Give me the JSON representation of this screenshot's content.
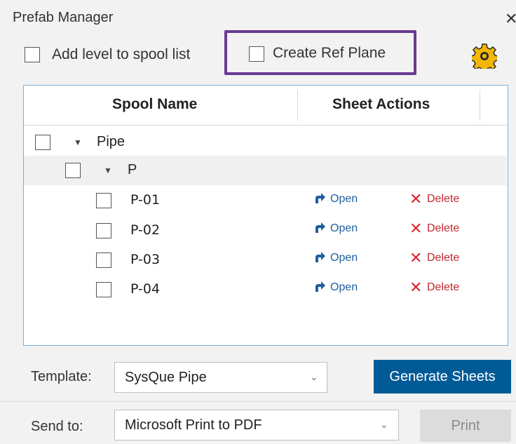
{
  "window": {
    "title": "Prefab Manager",
    "close_glyph": "✕"
  },
  "options": {
    "add_level_label": "Add level to spool list",
    "create_ref_plane_label": "Create Ref Plane",
    "settings_icon": "gear-icon",
    "highlight_color": "#6a3a92"
  },
  "table": {
    "columns": [
      "Spool Name",
      "Sheet Actions"
    ],
    "groups": [
      {
        "label": "Pipe"
      },
      {
        "label": "P"
      }
    ],
    "rows": [
      {
        "name": "P-01",
        "open": "Open",
        "delete": "Delete"
      },
      {
        "name": "P-02",
        "open": "Open",
        "delete": "Delete"
      },
      {
        "name": "P-03",
        "open": "Open",
        "delete": "Delete"
      },
      {
        "name": "P-04",
        "open": "Open",
        "delete": "Delete"
      }
    ]
  },
  "footer": {
    "template_label": "Template:",
    "template_value": "SysQue Pipe",
    "generate_button": "Generate Sheets",
    "send_to_label": "Send to:",
    "send_to_value": "Microsoft Print to PDF",
    "print_button": "Print"
  },
  "colors": {
    "accent": "#005a96",
    "link": "#1f5f9e",
    "delete": "#d8262c",
    "gear": "#f2b705"
  }
}
